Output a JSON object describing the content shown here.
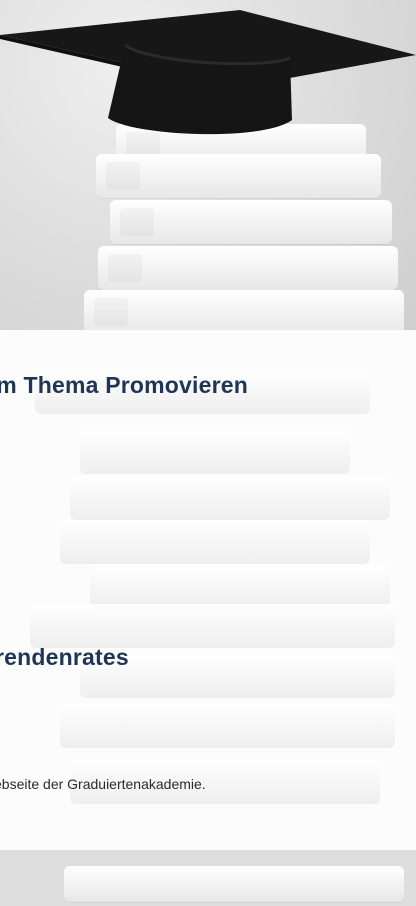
{
  "sections": {
    "promovieren": {
      "heading": "um Thema Promovieren"
    },
    "doktorandenrat": {
      "heading": "erendenrates",
      "text": "ebseite der Graduiertenakademie."
    }
  },
  "illustration": {
    "icon": "graduation-cap-icon",
    "colors": {
      "cap": "#141414",
      "heading": "#1f3556"
    }
  }
}
